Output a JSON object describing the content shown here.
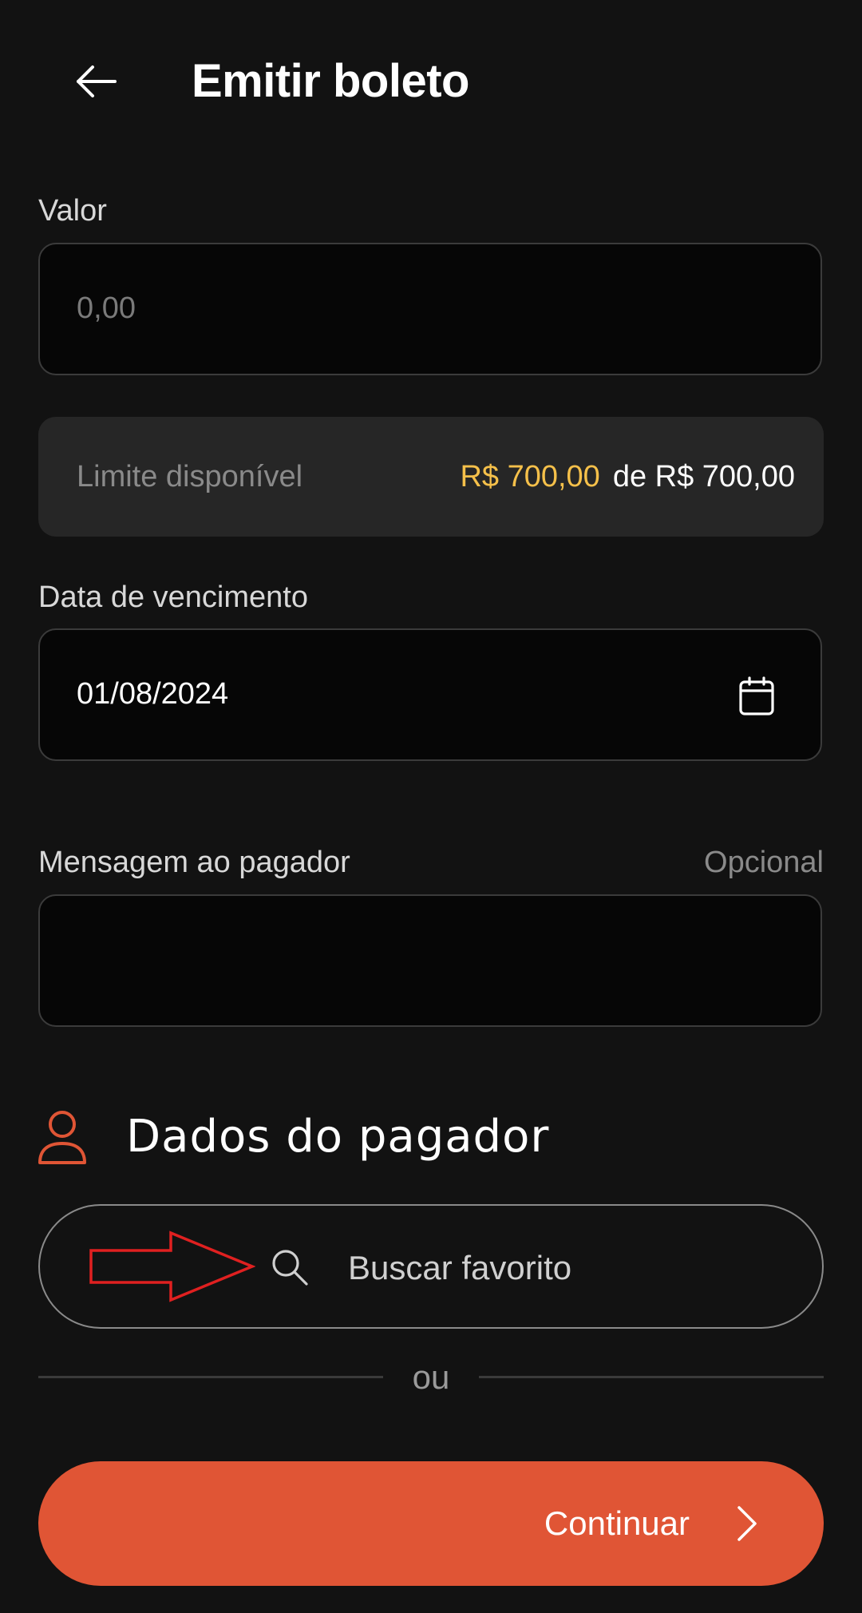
{
  "header": {
    "title": "Emitir boleto"
  },
  "valor": {
    "label": "Valor",
    "placeholder": "0,00"
  },
  "limite": {
    "label": "Limite disponível",
    "available": "R$ 700,00",
    "total": "de R$ 700,00"
  },
  "vencimento": {
    "label": "Data de vencimento",
    "value": "01/08/2024"
  },
  "mensagem": {
    "label": "Mensagem ao pagador",
    "optional": "Opcional",
    "value": ""
  },
  "pagador": {
    "title": "Dados do pagador",
    "search_label": "Buscar favorito",
    "divider_text": "ou"
  },
  "footer": {
    "continue_label": "Continuar"
  },
  "colors": {
    "accent": "#e05535",
    "highlight": "#f5c04a",
    "annotation_arrow": "#e02020"
  }
}
